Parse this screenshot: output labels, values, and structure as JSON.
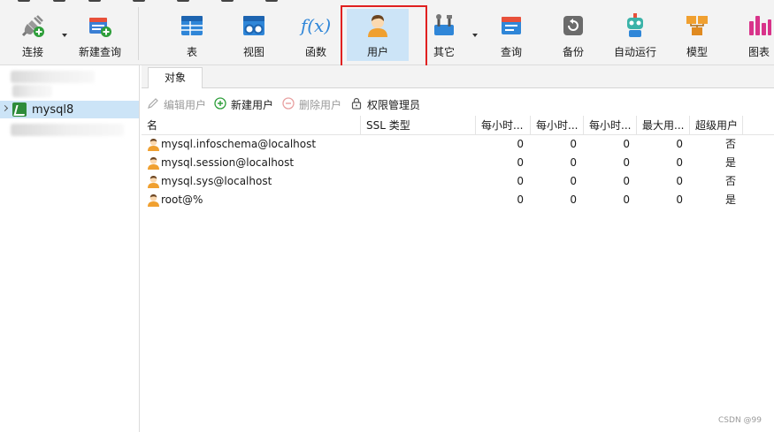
{
  "toolbar": {
    "items": [
      {
        "label": "连接",
        "icon": "plug-icon"
      },
      {
        "label": "新建查询",
        "icon": "new-query-icon"
      },
      {
        "label": "表",
        "icon": "table-icon"
      },
      {
        "label": "视图",
        "icon": "view-icon"
      },
      {
        "label": "函数",
        "icon": "function-icon",
        "glyph": "f(x)"
      },
      {
        "label": "用户",
        "icon": "user-icon"
      },
      {
        "label": "其它",
        "icon": "tools-icon"
      },
      {
        "label": "查询",
        "icon": "query-icon"
      },
      {
        "label": "备份",
        "icon": "backup-icon"
      },
      {
        "label": "自动运行",
        "icon": "robot-icon"
      },
      {
        "label": "模型",
        "icon": "model-icon"
      },
      {
        "label": "图表",
        "icon": "chart-icon"
      }
    ],
    "active": "用户",
    "highlight_color": "#e02020",
    "active_color": "#cce4f7"
  },
  "sidebar": {
    "connection": "mysql8"
  },
  "tabs": [
    {
      "label": "对象"
    }
  ],
  "user_toolbar": {
    "edit": "编辑用户",
    "new": "新建用户",
    "delete": "删除用户",
    "privilege": "权限管理员"
  },
  "table": {
    "columns": [
      "名",
      "SSL 类型",
      "每小时...",
      "每小时...",
      "每小时...",
      "最大用...",
      "超级用户"
    ],
    "rows": [
      {
        "name": "mysql.infoschema@localhost",
        "ssl": "",
        "c1": "0",
        "c2": "0",
        "c3": "0",
        "c4": "0",
        "super": "否"
      },
      {
        "name": "mysql.session@localhost",
        "ssl": "",
        "c1": "0",
        "c2": "0",
        "c3": "0",
        "c4": "0",
        "super": "是"
      },
      {
        "name": "mysql.sys@localhost",
        "ssl": "",
        "c1": "0",
        "c2": "0",
        "c3": "0",
        "c4": "0",
        "super": "否"
      },
      {
        "name": "root@%",
        "ssl": "",
        "c1": "0",
        "c2": "0",
        "c3": "0",
        "c4": "0",
        "super": "是"
      }
    ]
  },
  "watermark": "CSDN @99"
}
